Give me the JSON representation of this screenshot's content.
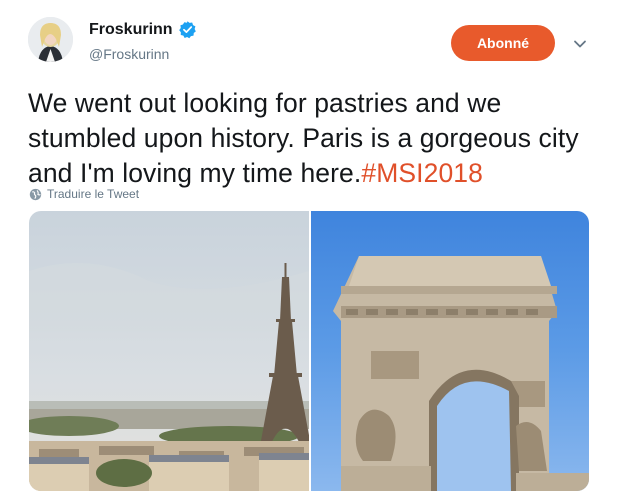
{
  "user": {
    "display_name": "Froskurinn",
    "handle": "@Froskurinn",
    "verified": true,
    "avatar_icon": "avatar-icon"
  },
  "follow_button": {
    "label": "Abonné",
    "color": "#e85a2c"
  },
  "tweet": {
    "text": "We went out looking for pastries and we stumbled upon history. Paris is a gorgeous city and I'm loving my time here.",
    "hashtag": "#MSI2018",
    "hashtag_color": "#e0502a"
  },
  "translate": {
    "label": "Traduire le Tweet",
    "icon": "globe-icon"
  },
  "media": {
    "photos": [
      {
        "subject": "eiffel-tower-photo"
      },
      {
        "subject": "arc-de-triomphe-photo"
      }
    ]
  }
}
